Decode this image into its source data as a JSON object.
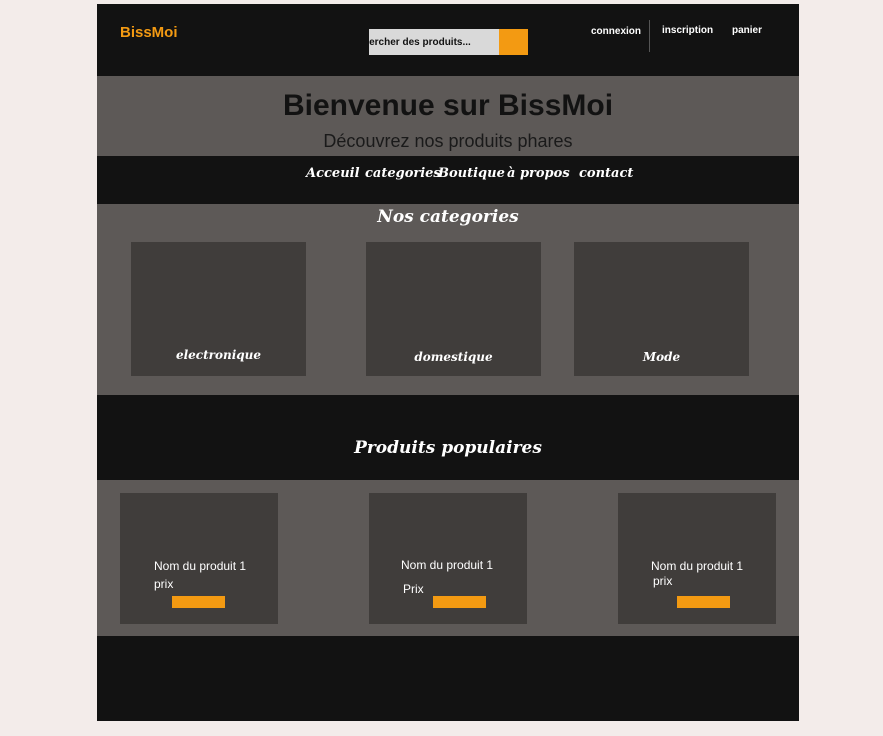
{
  "header": {
    "logo": "BissMoi",
    "search_placeholder": "hercher des produits...",
    "auth": {
      "login": "connexion",
      "signup": "inscription",
      "cart": "panier"
    }
  },
  "hero": {
    "title": "Bienvenue sur BissMoi",
    "subtitle": "Découvrez nos produits phares"
  },
  "nav": {
    "items": [
      "Acceuil",
      "categories",
      "Boutique",
      "à propos",
      "contact"
    ]
  },
  "categories": {
    "title": "Nos categories",
    "items": [
      "electronique",
      "domestique",
      "Mode"
    ]
  },
  "popular": {
    "title": "Produits populaires",
    "products": [
      {
        "name": "Nom du produit 1",
        "price": "prix"
      },
      {
        "name": "Nom du produit 1",
        "price": "Prix"
      },
      {
        "name": "Nom du produit 1",
        "price": "prix"
      }
    ]
  },
  "colors": {
    "accent": "#f39a12",
    "dark": "#121212",
    "panel": "#5d5957",
    "card": "#403d3b",
    "page_background": "#f3ecea"
  }
}
